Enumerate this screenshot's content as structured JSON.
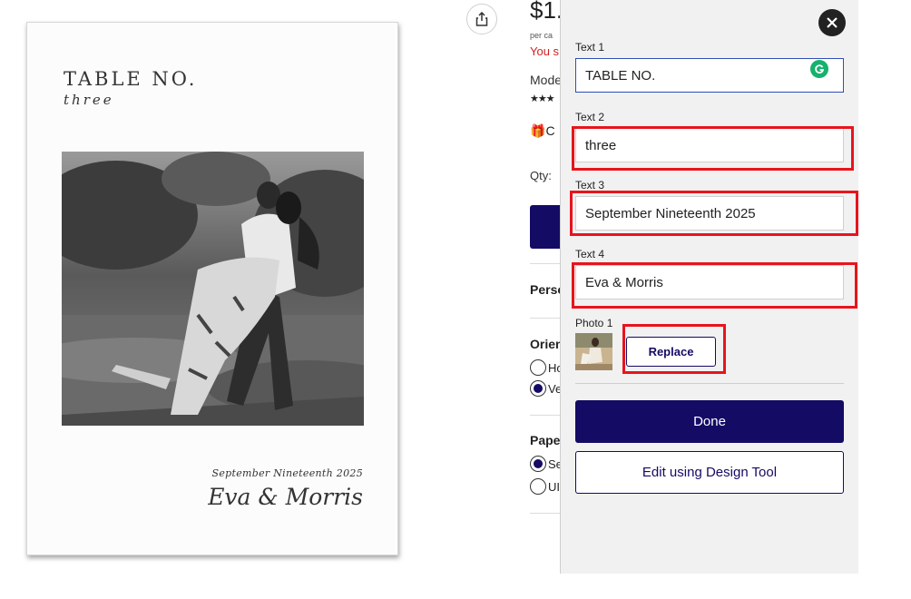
{
  "card": {
    "title": "TABLE NO.",
    "subtitle": "three",
    "date": "September Nineteenth 2025",
    "names": "Eva & Morris"
  },
  "product": {
    "price_partial": "$1.",
    "per_card_partial": "per ca",
    "savings_partial": "You s",
    "model_partial": "Mode",
    "stars": "★★★",
    "gift_partial": "C",
    "qty_label": "Qty:",
    "personalize_partial": "Perso",
    "orientation_heading_partial": "Orien",
    "orientation_options": [
      {
        "label": "Ho",
        "selected": false
      },
      {
        "label": "Ve",
        "selected": true
      }
    ],
    "paper_heading_partial": "Pape",
    "paper_options": [
      {
        "label": "Se",
        "selected": true
      },
      {
        "label": "UI",
        "selected": false
      }
    ]
  },
  "editor": {
    "fields": [
      {
        "label": "Text 1",
        "value": "TABLE NO.",
        "focused": true
      },
      {
        "label": "Text 2",
        "value": "three",
        "highlighted": true
      },
      {
        "label": "Text 3",
        "value": "September Nineteenth 2025",
        "highlighted": true
      },
      {
        "label": "Text 4",
        "value": "Eva & Morris",
        "highlighted": true
      }
    ],
    "photo_label": "Photo 1",
    "replace_label": "Replace",
    "done_label": "Done",
    "design_tool_label": "Edit using Design Tool"
  },
  "icons": {
    "share": "share-icon",
    "close": "close-icon",
    "grammarly": "grammarly-icon",
    "gift": "gift-icon"
  },
  "colors": {
    "brand_navy": "#140b65",
    "highlight_red": "#e8141c",
    "focus_blue": "#2f4fb4",
    "sale_red": "#d31f1f",
    "grammarly_green": "#14b26d"
  }
}
